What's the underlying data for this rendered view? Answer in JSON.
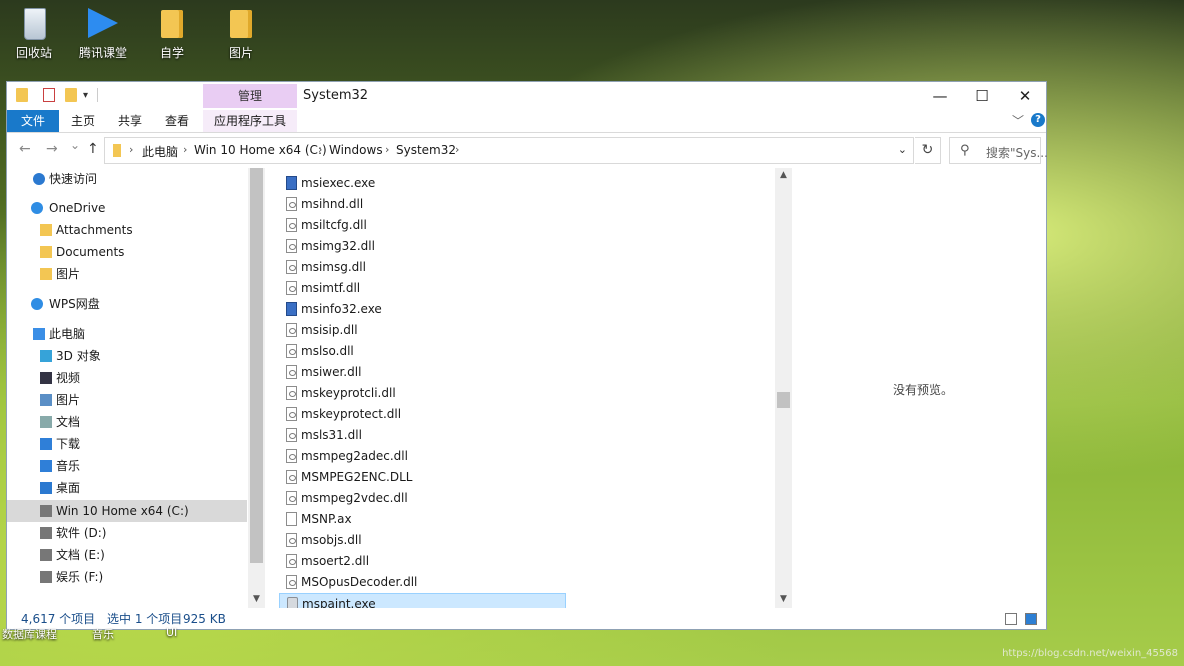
{
  "desktop": {
    "icons": [
      {
        "label": "回收站",
        "icon": "recycle-bin-icon"
      },
      {
        "label": "腾讯课堂",
        "icon": "tencent-classroom-icon"
      },
      {
        "label": "自学",
        "icon": "folder-icon"
      },
      {
        "label": "图片",
        "icon": "folder-icon"
      }
    ]
  },
  "window": {
    "title": "System32",
    "manage_tab": "管理",
    "caption": {
      "minimize": "—",
      "maximize": "☐",
      "close": "✕"
    }
  },
  "ribbon": {
    "tabs": [
      "文件",
      "主页",
      "共享",
      "查看",
      "应用程序工具"
    ],
    "help": "?"
  },
  "address": {
    "back": "←",
    "forward": "→",
    "recent": "⌄",
    "up": "↑",
    "crumbs": [
      "此电脑",
      "Win 10 Home x64 (C:)",
      "Windows",
      "System32"
    ],
    "refresh": "↻",
    "search_placeholder": "搜索\"Sys..."
  },
  "nav": {
    "items": [
      {
        "label": "快速访问",
        "icon": "star-icon"
      },
      {
        "label": "OneDrive",
        "icon": "cloud-icon"
      },
      {
        "label": "Attachments",
        "icon": "folder-icon"
      },
      {
        "label": "Documents",
        "icon": "folder-icon"
      },
      {
        "label": "图片",
        "icon": "folder-icon"
      },
      {
        "label": "WPS网盘",
        "icon": "cloud-icon"
      },
      {
        "label": "此电脑",
        "icon": "computer-icon"
      },
      {
        "label": "3D 对象",
        "icon": "cube-icon"
      },
      {
        "label": "视频",
        "icon": "video-icon"
      },
      {
        "label": "图片",
        "icon": "pictures-icon"
      },
      {
        "label": "文档",
        "icon": "documents-icon"
      },
      {
        "label": "下载",
        "icon": "download-icon"
      },
      {
        "label": "音乐",
        "icon": "music-icon"
      },
      {
        "label": "桌面",
        "icon": "desktop-icon"
      },
      {
        "label": "Win 10 Home x64 (C:)",
        "icon": "drive-icon"
      },
      {
        "label": "软件 (D:)",
        "icon": "drive-icon"
      },
      {
        "label": "文档 (E:)",
        "icon": "drive-icon"
      },
      {
        "label": "娱乐 (F:)",
        "icon": "drive-icon"
      }
    ]
  },
  "files": [
    {
      "name": "msiexec.exe",
      "kind": "exe"
    },
    {
      "name": "msihnd.dll",
      "kind": "dll"
    },
    {
      "name": "msiltcfg.dll",
      "kind": "dll"
    },
    {
      "name": "msimg32.dll",
      "kind": "dll"
    },
    {
      "name": "msimsg.dll",
      "kind": "dll"
    },
    {
      "name": "msimtf.dll",
      "kind": "dll"
    },
    {
      "name": "msinfo32.exe",
      "kind": "exe"
    },
    {
      "name": "msisip.dll",
      "kind": "dll"
    },
    {
      "name": "mslso.dll",
      "kind": "dll"
    },
    {
      "name": "msiwer.dll",
      "kind": "dll"
    },
    {
      "name": "mskeyprotcli.dll",
      "kind": "dll"
    },
    {
      "name": "mskeyprotect.dll",
      "kind": "dll"
    },
    {
      "name": "msls31.dll",
      "kind": "dll"
    },
    {
      "name": "msmpeg2adec.dll",
      "kind": "dll"
    },
    {
      "name": "MSMPEG2ENC.DLL",
      "kind": "dll"
    },
    {
      "name": "msmpeg2vdec.dll",
      "kind": "dll"
    },
    {
      "name": "MSNP.ax",
      "kind": "file"
    },
    {
      "name": "msobjs.dll",
      "kind": "dll"
    },
    {
      "name": "msoert2.dll",
      "kind": "dll"
    },
    {
      "name": "MSOpusDecoder.dll",
      "kind": "dll"
    },
    {
      "name": "mspaint.exe",
      "kind": "paint"
    }
  ],
  "selected_file": "mspaint.exe",
  "preview": {
    "text": "没有预览。"
  },
  "status": {
    "count": "4,617 个项目",
    "selection": "选中 1 个项目",
    "size": "925 KB"
  },
  "taskstrip": {
    "left": "数据库课程",
    "mid": "音乐",
    "right": "UI"
  },
  "watermark": "https://blog.csdn.net/weixin_45568"
}
